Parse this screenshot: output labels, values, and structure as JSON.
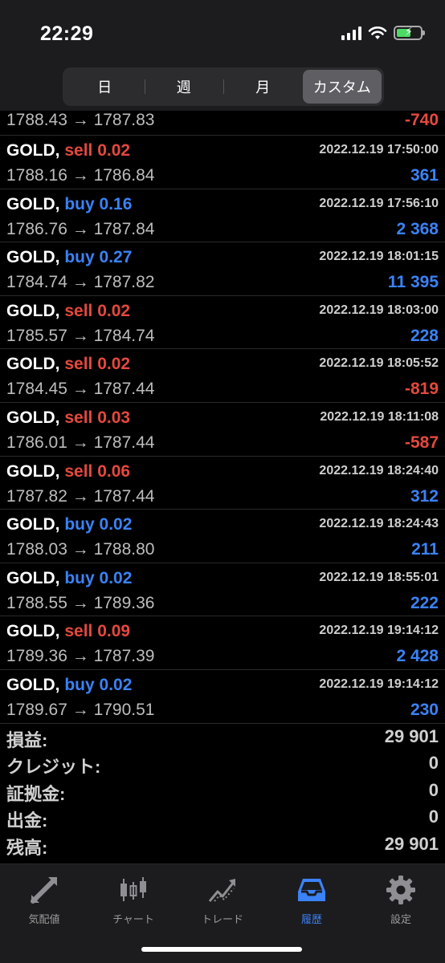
{
  "status": {
    "time": "22:29"
  },
  "segments": [
    {
      "label": "日",
      "active": false
    },
    {
      "label": "週",
      "active": false
    },
    {
      "label": "月",
      "active": false
    },
    {
      "label": "カスタム",
      "active": true
    }
  ],
  "partial_row": {
    "prices": "1788.43 → 1787.83",
    "profit": "-740",
    "profit_sign": "neg"
  },
  "trades": [
    {
      "symbol": "GOLD,",
      "side": "sell",
      "volume": "0.02",
      "datetime": "2022.12.19 17:50:00",
      "prices": "1788.16 → 1786.84",
      "profit": "361",
      "profit_sign": "pos"
    },
    {
      "symbol": "GOLD,",
      "side": "buy",
      "volume": "0.16",
      "datetime": "2022.12.19 17:56:10",
      "prices": "1786.76 → 1787.84",
      "profit": "2 368",
      "profit_sign": "pos"
    },
    {
      "symbol": "GOLD,",
      "side": "buy",
      "volume": "0.27",
      "datetime": "2022.12.19 18:01:15",
      "prices": "1784.74 → 1787.82",
      "profit": "11 395",
      "profit_sign": "pos"
    },
    {
      "symbol": "GOLD,",
      "side": "sell",
      "volume": "0.02",
      "datetime": "2022.12.19 18:03:00",
      "prices": "1785.57 → 1784.74",
      "profit": "228",
      "profit_sign": "pos"
    },
    {
      "symbol": "GOLD,",
      "side": "sell",
      "volume": "0.02",
      "datetime": "2022.12.19 18:05:52",
      "prices": "1784.45 → 1787.44",
      "profit": "-819",
      "profit_sign": "neg"
    },
    {
      "symbol": "GOLD,",
      "side": "sell",
      "volume": "0.03",
      "datetime": "2022.12.19 18:11:08",
      "prices": "1786.01 → 1787.44",
      "profit": "-587",
      "profit_sign": "neg"
    },
    {
      "symbol": "GOLD,",
      "side": "sell",
      "volume": "0.06",
      "datetime": "2022.12.19 18:24:40",
      "prices": "1787.82 → 1787.44",
      "profit": "312",
      "profit_sign": "pos"
    },
    {
      "symbol": "GOLD,",
      "side": "buy",
      "volume": "0.02",
      "datetime": "2022.12.19 18:24:43",
      "prices": "1788.03 → 1788.80",
      "profit": "211",
      "profit_sign": "pos"
    },
    {
      "symbol": "GOLD,",
      "side": "buy",
      "volume": "0.02",
      "datetime": "2022.12.19 18:55:01",
      "prices": "1788.55 → 1789.36",
      "profit": "222",
      "profit_sign": "pos"
    },
    {
      "symbol": "GOLD,",
      "side": "sell",
      "volume": "0.09",
      "datetime": "2022.12.19 19:14:12",
      "prices": "1789.36 → 1787.39",
      "profit": "2 428",
      "profit_sign": "pos"
    },
    {
      "symbol": "GOLD,",
      "side": "buy",
      "volume": "0.02",
      "datetime": "2022.12.19 19:14:12",
      "prices": "1789.67 → 1790.51",
      "profit": "230",
      "profit_sign": "pos"
    }
  ],
  "summary": [
    {
      "label": "損益:",
      "value": "29 901"
    },
    {
      "label": "クレジット:",
      "value": "0"
    },
    {
      "label": "証拠金:",
      "value": "0"
    },
    {
      "label": "出金:",
      "value": "0"
    },
    {
      "label": "残高:",
      "value": "29 901"
    }
  ],
  "tabs": [
    {
      "label": "気配値",
      "icon": "quotes-arrows-icon",
      "active": false
    },
    {
      "label": "チャート",
      "icon": "candlestick-chart-icon",
      "active": false
    },
    {
      "label": "トレード",
      "icon": "trade-line-icon",
      "active": false
    },
    {
      "label": "履歴",
      "icon": "history-tray-icon",
      "active": true
    },
    {
      "label": "設定",
      "icon": "gear-icon",
      "active": false
    }
  ],
  "colors": {
    "sell": "#e5483f",
    "buy": "#3b82f6",
    "accent": "#3b82f6"
  }
}
